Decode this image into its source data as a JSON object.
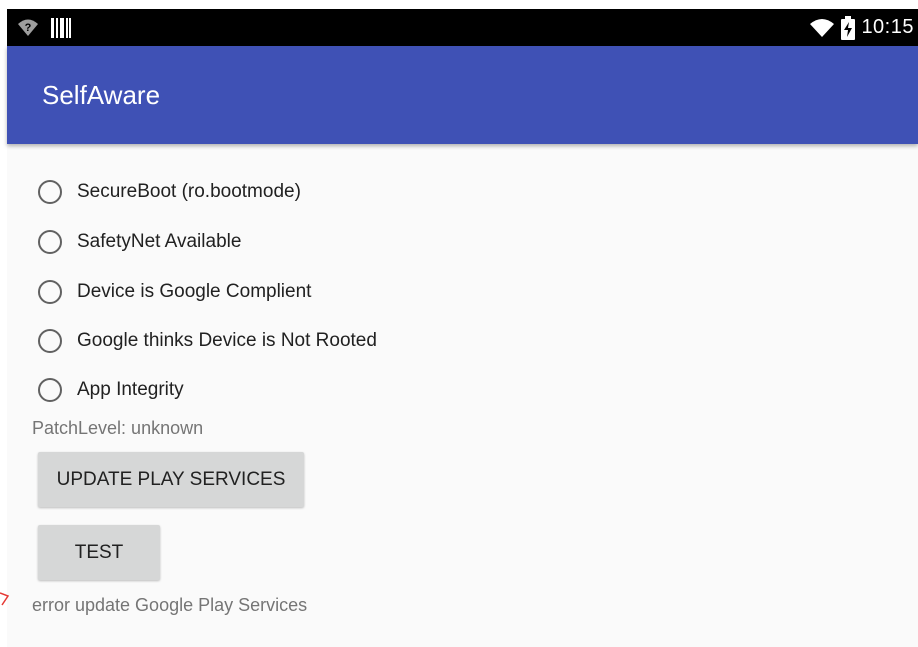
{
  "status_bar": {
    "time": "10:15",
    "icons": {
      "signal": "signal-unknown-icon",
      "notification": "barcode-notification-icon",
      "wifi": "wifi-icon",
      "battery": "battery-charging-icon"
    }
  },
  "app_bar": {
    "title": "SelfAware",
    "color": "#3f51b5"
  },
  "checks": [
    {
      "label": "SecureBoot (ro.bootmode)",
      "checked": false
    },
    {
      "label": "SafetyNet Available",
      "checked": false
    },
    {
      "label": "Device is Google Complient",
      "checked": false
    },
    {
      "label": "Google thinks Device is Not Rooted",
      "checked": false
    },
    {
      "label": "App Integrity",
      "checked": false
    }
  ],
  "patch_level": "PatchLevel: unknown",
  "buttons": {
    "update_play_services": "UPDATE PLAY SERVICES",
    "test": "TEST"
  },
  "error_message": "error update Google Play Services"
}
